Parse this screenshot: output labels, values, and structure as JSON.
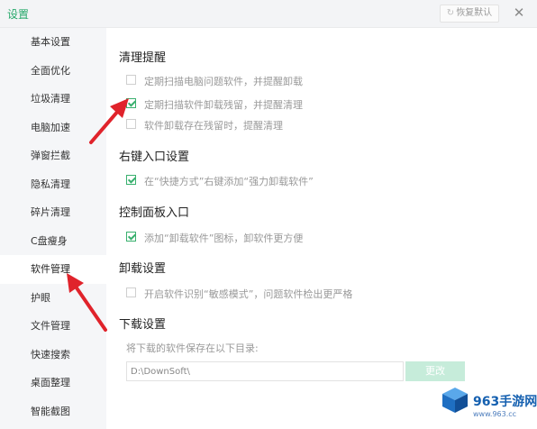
{
  "window": {
    "title": "设置",
    "restore_label": "恢复默认",
    "close_glyph": "✕",
    "restore_glyph": "↻"
  },
  "sidebar": {
    "items": [
      {
        "label": "基本设置"
      },
      {
        "label": "全面优化"
      },
      {
        "label": "垃圾清理"
      },
      {
        "label": "电脑加速"
      },
      {
        "label": "弹窗拦截"
      },
      {
        "label": "隐私清理"
      },
      {
        "label": "碎片清理"
      },
      {
        "label": "C盘瘦身"
      },
      {
        "label": "软件管理",
        "active": true
      },
      {
        "label": "护眼"
      },
      {
        "label": "文件管理"
      },
      {
        "label": "快速搜索"
      },
      {
        "label": "桌面整理"
      },
      {
        "label": "智能截图"
      }
    ]
  },
  "sections": {
    "cleanup": {
      "title": "清理提醒",
      "options": [
        {
          "label": "定期扫描电脑问题软件，并提醒卸载",
          "checked": false
        },
        {
          "label": "定期扫描软件卸载残留，并提醒清理",
          "checked": true
        },
        {
          "label": "软件卸载存在残留时，提醒清理",
          "checked": false
        }
      ]
    },
    "context_menu": {
      "title": "右键入口设置",
      "options": [
        {
          "label": "在“快捷方式”右键添加“强力卸载软件”",
          "checked": true
        }
      ]
    },
    "control_panel": {
      "title": "控制面板入口",
      "options": [
        {
          "label": "添加“卸载软件”图标，卸软件更方便",
          "checked": true
        }
      ]
    },
    "uninstall": {
      "title": "卸载设置",
      "options": [
        {
          "label": "开启软件识别“敏感模式”，问题软件检出更严格",
          "checked": false
        }
      ]
    },
    "download": {
      "title": "下载设置",
      "hint": "将下载的软件保存在以下目录:",
      "path": "D:\\DownSoft\\",
      "change_label": "更改"
    }
  },
  "watermark": {
    "text": "963手游网",
    "url": "www.963.cc"
  },
  "colors": {
    "accent": "#39b06e",
    "title_green": "#25a86a",
    "sidebar_bg": "#f5f6f8",
    "arrow_red": "#e0232b",
    "watermark_blue": "#1560b0"
  }
}
